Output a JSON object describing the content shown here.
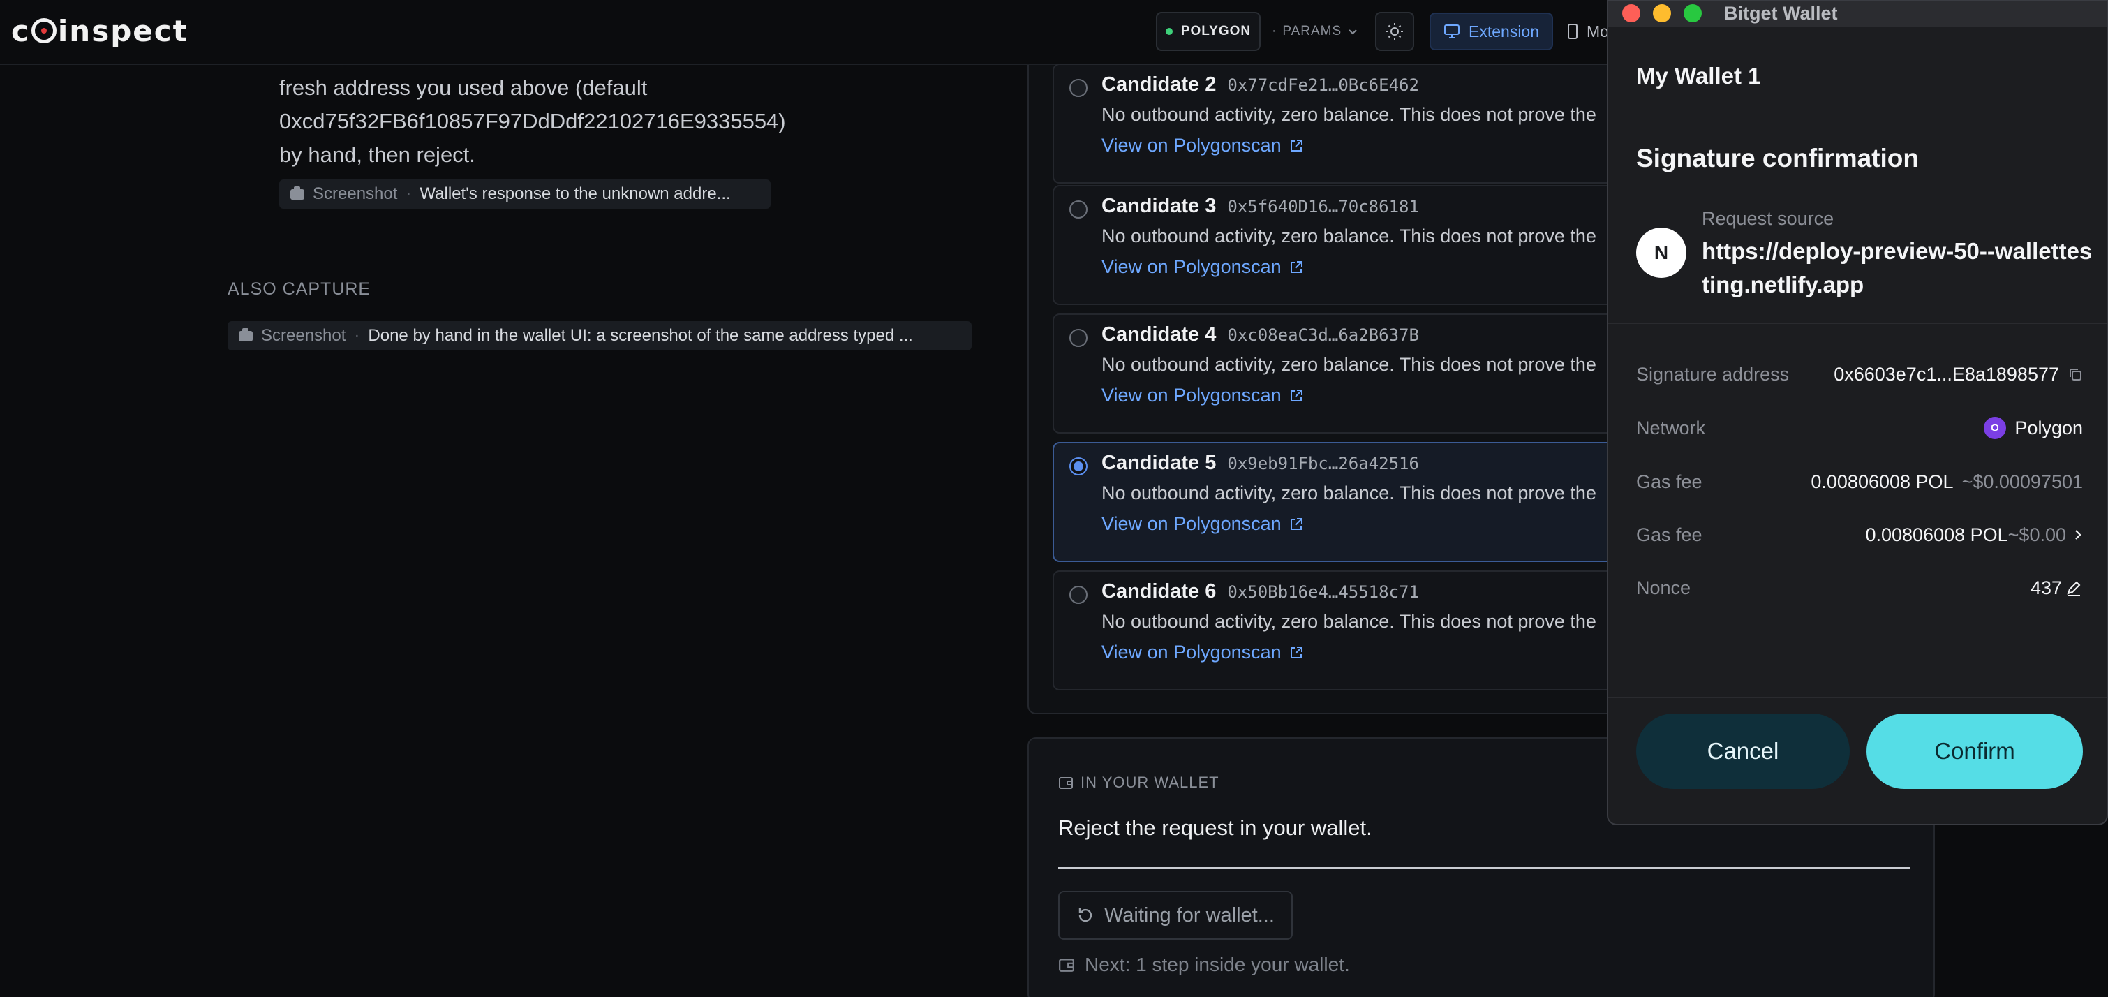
{
  "topbar": {
    "logo": "coinspect",
    "network": "POLYGON",
    "params_label": "PARAMS",
    "mode_extension": "Extension",
    "mode_mobile": "Mo"
  },
  "left": {
    "paragraph_lines": [
      "fresh address you used above (default",
      "0xcd75f32FB6f10857F97DdDdf22102716E9335554)",
      "by hand, then reject."
    ],
    "chip1": {
      "kind": "Screenshot",
      "sep": "·",
      "text": "Wallet's response to the unknown addre..."
    },
    "also_capture_label": "ALSO CAPTURE",
    "chip2": {
      "kind": "Screenshot",
      "sep": "·",
      "text": "Done by hand in the wallet UI: a screenshot of the same address typed ..."
    }
  },
  "candidates": [
    {
      "title": "Candidate 2",
      "address": "0x77cdFe21…0Bc6E462",
      "desc": "No outbound activity, zero balance. This does not prove the",
      "link": "View on Polygonscan",
      "selected": false
    },
    {
      "title": "Candidate 3",
      "address": "0x5f640D16…70c86181",
      "desc": "No outbound activity, zero balance. This does not prove the",
      "link": "View on Polygonscan",
      "selected": false
    },
    {
      "title": "Candidate 4",
      "address": "0xc08eaC3d…6a2B637B",
      "desc": "No outbound activity, zero balance. This does not prove the",
      "link": "View on Polygonscan",
      "selected": false
    },
    {
      "title": "Candidate 5",
      "address": "0x9eb91Fbc…26a42516",
      "desc": "No outbound activity, zero balance. This does not prove the",
      "link": "View on Polygonscan",
      "selected": true
    },
    {
      "title": "Candidate 6",
      "address": "0x50Bb16e4…45518c71",
      "desc": "No outbound activity, zero balance. This does not prove the",
      "link": "View on Polygonscan",
      "selected": false
    }
  ],
  "wallet_card": {
    "label": "IN YOUR WALLET",
    "title": "Reject the request in your wallet.",
    "waiting": "Waiting for wallet...",
    "next": "Next: 1 step inside your wallet."
  },
  "bitget": {
    "window_title": "Bitget Wallet",
    "wallet_name": "My Wallet 1",
    "heading": "Signature confirmation",
    "avatar_letter": "N",
    "request_source_label": "Request source",
    "request_source_url": "https://deploy-preview-50--wallettesting.netlify.app",
    "rows": {
      "sig_label": "Signature address",
      "sig_value": "0x6603e7c1...E8a1898577",
      "network_label": "Network",
      "network_value": "Polygon",
      "gas1_label": "Gas fee",
      "gas1_value": "0.00806008 POL",
      "gas1_usd": "~$0.00097501",
      "gas2_label": "Gas fee",
      "gas2_value": "0.00806008 POL",
      "gas2_usd": "~$0.00",
      "nonce_label": "Nonce",
      "nonce_value": "437"
    },
    "cancel": "Cancel",
    "confirm": "Confirm"
  }
}
